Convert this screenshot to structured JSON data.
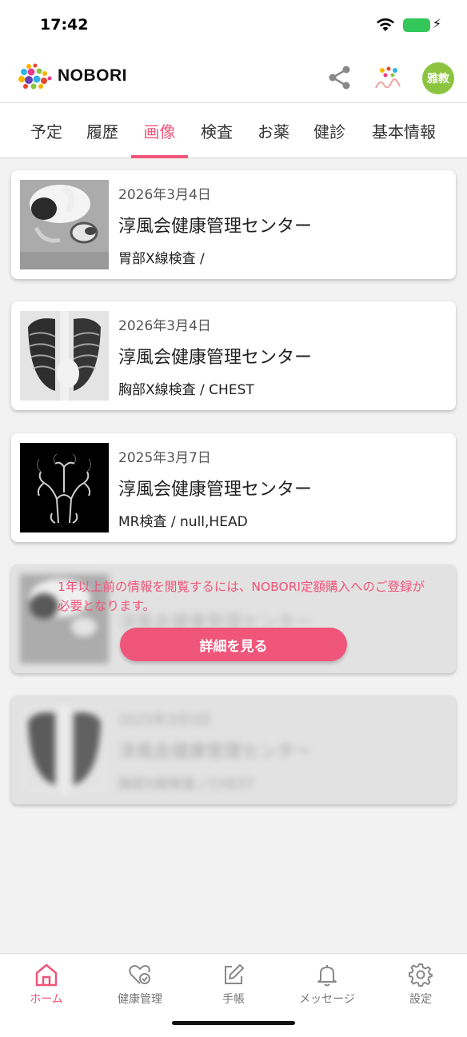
{
  "status_bar": {
    "time": "17:42"
  },
  "header": {
    "logo_text": "NOBORI",
    "avatar_text": "雅教"
  },
  "tabs": [
    {
      "label": "予定"
    },
    {
      "label": "履歴"
    },
    {
      "label": "画像",
      "active": true
    },
    {
      "label": "検査"
    },
    {
      "label": "お薬"
    },
    {
      "label": "健診"
    },
    {
      "label": "基本情報"
    }
  ],
  "records": [
    {
      "date": "2026年3月4日",
      "facility": "淳風会健康管理センター",
      "exam": "胃部X線検査 /",
      "image": "stomach-xray"
    },
    {
      "date": "2026年3月4日",
      "facility": "淳風会健康管理センター",
      "exam": "胸部X線検査 / CHEST",
      "image": "chest-xray"
    },
    {
      "date": "2025年3月7日",
      "facility": "淳風会健康管理センター",
      "exam": "MR検査 / null,HEAD",
      "image": "head-mra"
    }
  ],
  "locked_records": [
    {
      "date": "",
      "facility": "淳風会健康管理センター",
      "exam": "",
      "image": "stomach-xray"
    },
    {
      "date": "2025年3月3日",
      "facility": "淳風会健康管理センター",
      "exam": "胸部X線検査 / CHEST",
      "image": "chest-xray"
    }
  ],
  "lock_notice": {
    "message": "1年以上前の情報を閲覧するには、NOBORI定額購入へのご登録が必要となります。",
    "button_label": "詳細を見る"
  },
  "bottom_nav": [
    {
      "label": "ホーム",
      "icon": "home-icon",
      "active": true
    },
    {
      "label": "健康管理",
      "icon": "heart-check-icon"
    },
    {
      "label": "手帳",
      "icon": "notebook-edit-icon"
    },
    {
      "label": "メッセージ",
      "icon": "bell-icon"
    },
    {
      "label": "設定",
      "icon": "gear-icon"
    }
  ],
  "colors": {
    "accent": "#f0557a",
    "avatar_bg": "#8cc43f",
    "battery": "#34c759"
  }
}
